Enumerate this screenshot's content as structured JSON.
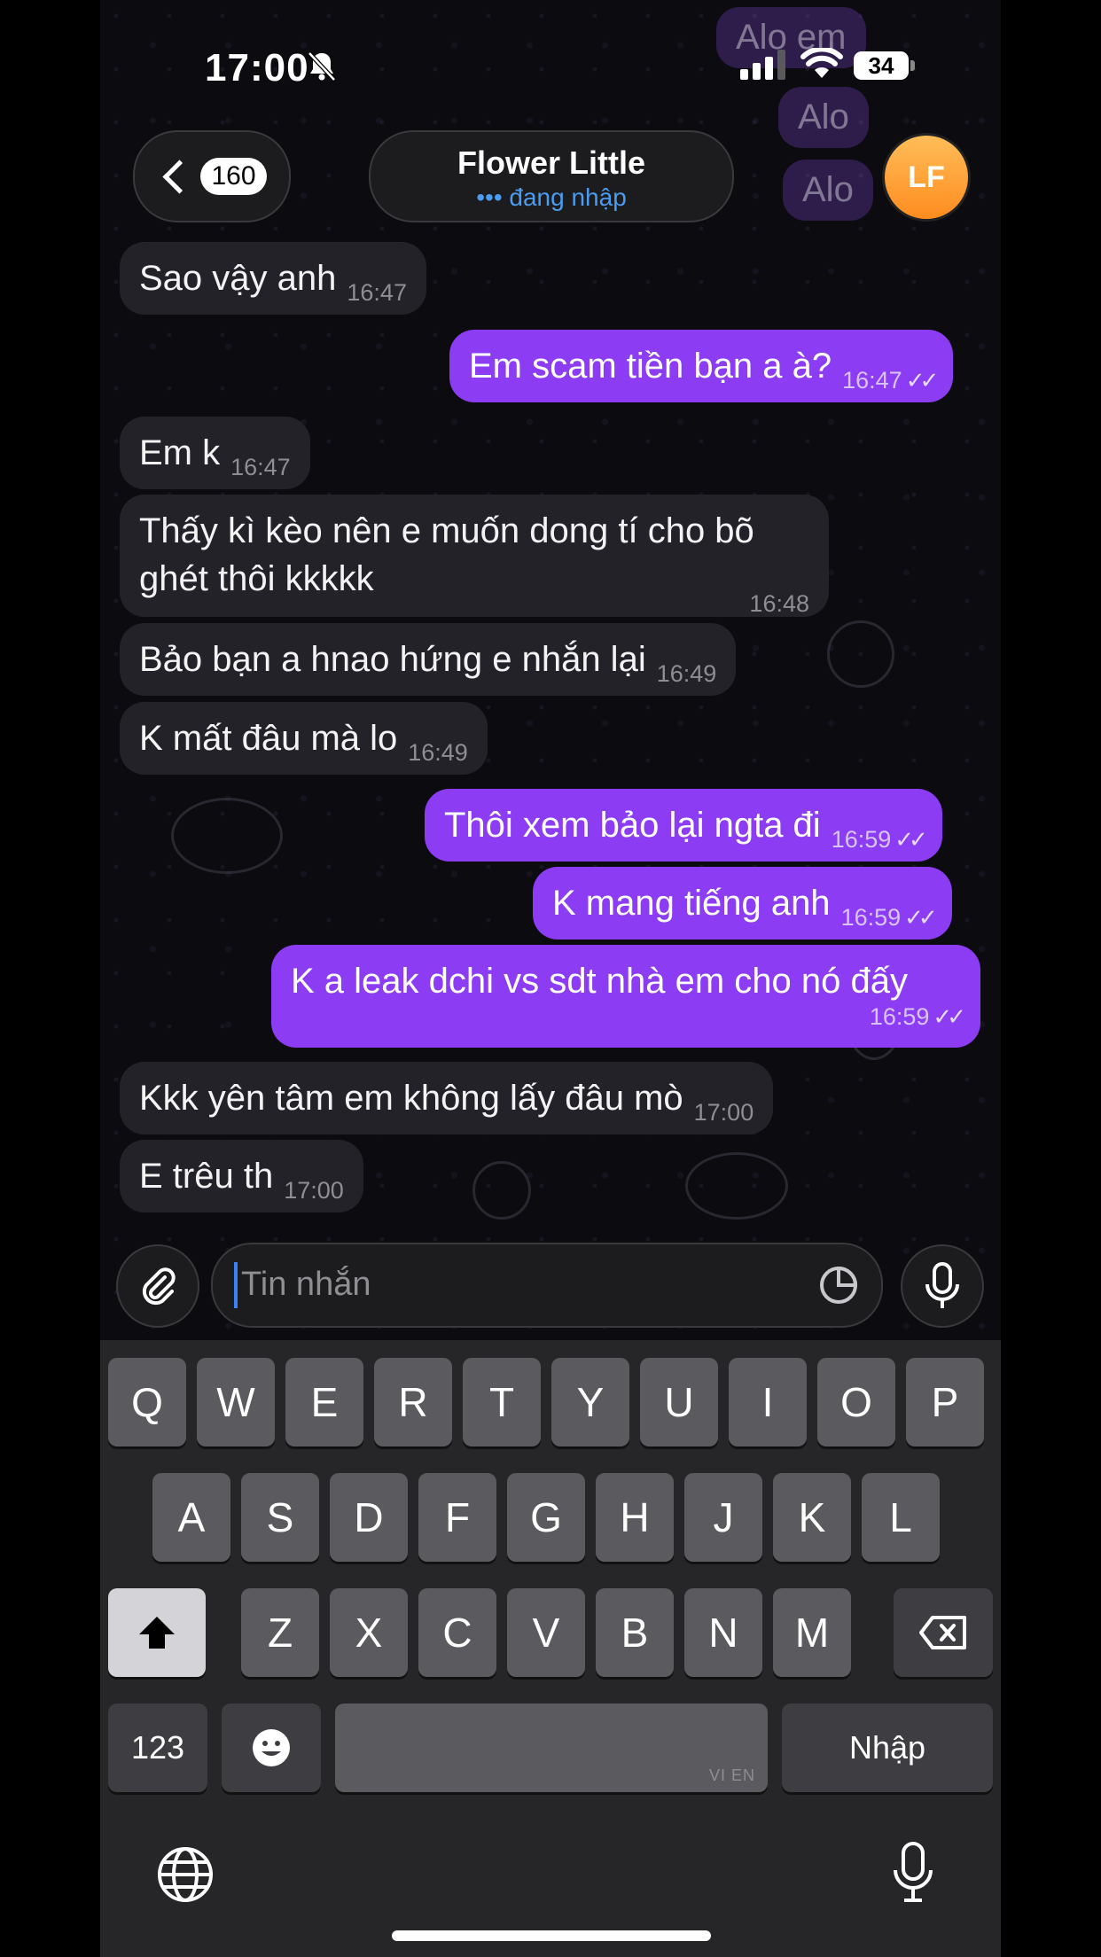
{
  "status_bar": {
    "time": "17:00",
    "battery": "34"
  },
  "header": {
    "back_count": "160",
    "title": "Flower Little",
    "subtitle": "••• đang nhập",
    "avatar_initials": "LF"
  },
  "ghost_bubbles": [
    "Alo em",
    "Alo",
    "Alo"
  ],
  "messages": [
    {
      "dir": "in",
      "text": "Sao vậy anh",
      "time": "16:47"
    },
    {
      "dir": "out",
      "text": "Em scam tiền bạn a à?",
      "time": "16:47",
      "ticks": "✓✓"
    },
    {
      "dir": "in",
      "text": "Em k",
      "time": "16:47"
    },
    {
      "dir": "in",
      "text": "Thấy kì kèo nên e muốn dong tí cho bõ ghét thôi kkkkk",
      "time": "16:48"
    },
    {
      "dir": "in",
      "text": "Bảo bạn a hnao hứng e nhắn lại",
      "time": "16:49"
    },
    {
      "dir": "in",
      "text": "K mất đâu mà lo",
      "time": "16:49"
    },
    {
      "dir": "out",
      "text": "Thôi xem bảo lại ngta đi",
      "time": "16:59",
      "ticks": "✓✓"
    },
    {
      "dir": "out",
      "text": "K mang tiếng anh",
      "time": "16:59",
      "ticks": "✓✓"
    },
    {
      "dir": "out",
      "text": "K a leak dchi vs sdt nhà em cho nó đấy",
      "time": "16:59",
      "ticks": "✓✓"
    },
    {
      "dir": "in",
      "text": "Kkk yên tâm em không lấy đâu mò",
      "time": "17:00"
    },
    {
      "dir": "in",
      "text": "E trêu th",
      "time": "17:00"
    }
  ],
  "composer": {
    "placeholder": "Tin nhắn"
  },
  "keyboard": {
    "row1": [
      "Q",
      "W",
      "E",
      "R",
      "T",
      "Y",
      "U",
      "I",
      "O",
      "P"
    ],
    "row2": [
      "A",
      "S",
      "D",
      "F",
      "G",
      "H",
      "J",
      "K",
      "L"
    ],
    "row3": [
      "Z",
      "X",
      "C",
      "V",
      "B",
      "N",
      "M"
    ],
    "numbers_key": "123",
    "return_key": "Nhập",
    "space_lang": "VI EN"
  },
  "colors": {
    "outgoing": "#8c3cf2",
    "incoming": "#232229",
    "accent": "#4a9cf0"
  }
}
